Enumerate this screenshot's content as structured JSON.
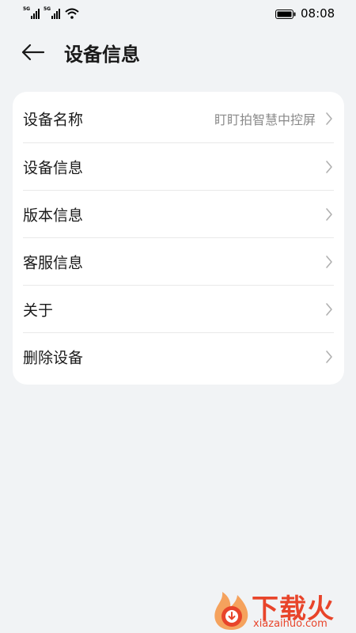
{
  "status_bar": {
    "time": "08:08",
    "sim1_tag": "5G",
    "sim2_tag": "5G",
    "icons": [
      "signal-icon",
      "signal-icon",
      "wifi-icon",
      "battery-icon"
    ]
  },
  "header": {
    "title": "设备信息",
    "back_icon": "arrow-left-icon"
  },
  "settings": [
    {
      "label": "设备名称",
      "value": "盯盯拍智慧中控屏"
    },
    {
      "label": "设备信息",
      "value": ""
    },
    {
      "label": "版本信息",
      "value": ""
    },
    {
      "label": "客服信息",
      "value": ""
    },
    {
      "label": "关于",
      "value": ""
    },
    {
      "label": "删除设备",
      "value": ""
    }
  ],
  "watermark": {
    "title": "下载火",
    "subtitle": "xiazaihuo.com"
  },
  "colors": {
    "background": "#f1f3f5",
    "card": "#ffffff",
    "text": "#191919",
    "secondary_text": "#8a8a8a",
    "watermark": "#e8442a"
  }
}
